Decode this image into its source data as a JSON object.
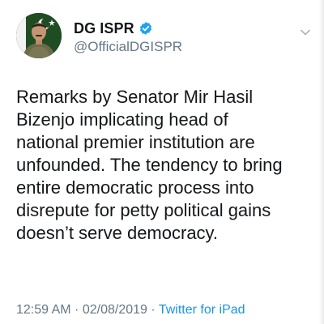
{
  "header": {
    "display_name": "DG ISPR",
    "handle": "@OfficialDGISPR",
    "verified_icon": "verified-badge-icon",
    "menu_icon": "chevron-down-icon"
  },
  "tweet": {
    "lines": [
      "Remarks by Senator Mir Hasil",
      "Bizenjo implicating head of",
      "national premier institution are",
      "unfounded. The tendency to bring",
      "entire democratic process into",
      "disrepute for petty political gains",
      "doesn’t serve democracy."
    ]
  },
  "meta": {
    "time": "12:59 AM",
    "separator": " · ",
    "date": "02/08/2019",
    "source": "Twitter for iPad"
  },
  "colors": {
    "text": "#14171a",
    "secondary": "#657786",
    "link": "#1b95e0",
    "verified": "#1da1f2"
  }
}
